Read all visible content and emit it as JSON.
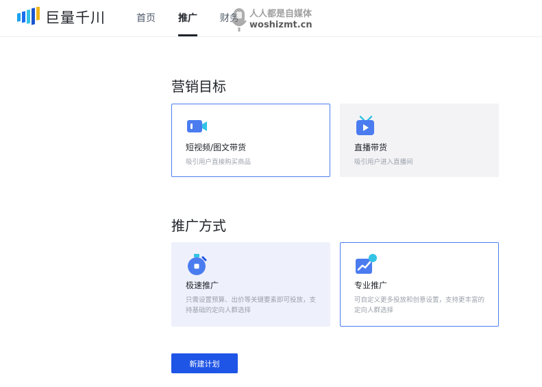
{
  "brand": {
    "name": "巨量千川"
  },
  "nav": {
    "items": [
      {
        "label": "首页"
      },
      {
        "label": "推广"
      },
      {
        "label": "财务"
      }
    ]
  },
  "watermark": {
    "line1": "人人都是自媒体",
    "line2": "woshizmt.cn"
  },
  "marketing_goal": {
    "title": "营销目标",
    "cards": [
      {
        "title": "短视频/图文带货",
        "desc": "吸引用户直接购买商品",
        "icon": "video-camera-icon"
      },
      {
        "title": "直播带货",
        "desc": "吸引用户进入直播间",
        "icon": "tv-play-icon"
      }
    ]
  },
  "promo_method": {
    "title": "推广方式",
    "cards": [
      {
        "title": "极速推广",
        "desc": "只需设置预算、出价等关键要素即可投放，支持基础的定向人群选择",
        "icon": "stopwatch-icon"
      },
      {
        "title": "专业推广",
        "desc": "可自定义更多投放和创意设置，支持更丰富的定向人群选择",
        "icon": "trend-chart-icon"
      }
    ]
  },
  "actions": {
    "create_plan": "新建计划"
  },
  "colors": {
    "primary": "#1f55e6",
    "accent_icon": "#4a7cf0",
    "selected_border": "#4a7cf0"
  }
}
